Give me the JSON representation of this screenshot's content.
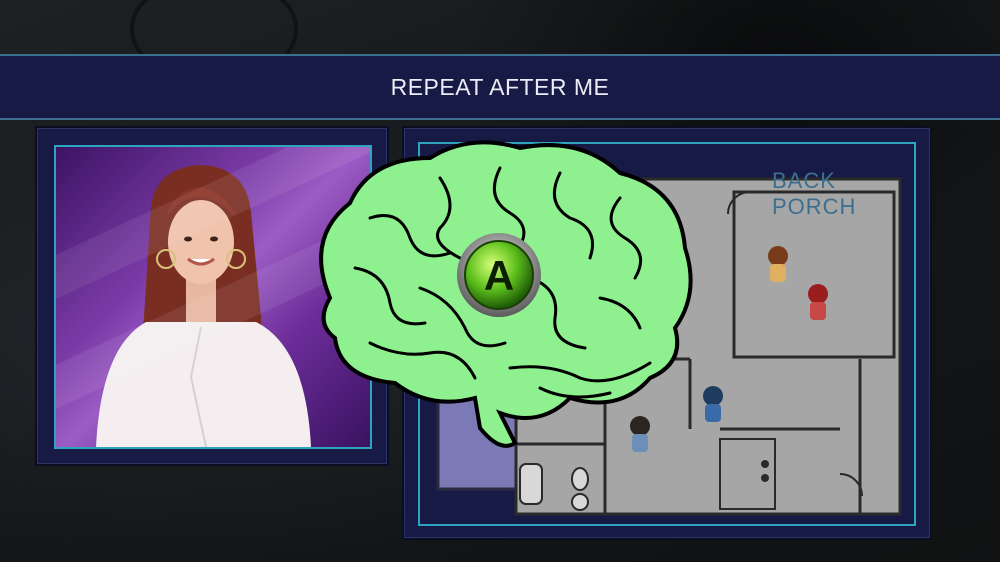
{
  "header": {
    "title": "REPEAT AFTER ME"
  },
  "map": {
    "location_label": "BACK PORCH"
  },
  "prompt_button": {
    "label": "A",
    "icon": "a-button-icon",
    "color": "#5ec01c"
  },
  "brain": {
    "icon": "brain-icon",
    "color": "#8ef08e"
  },
  "colors": {
    "panel": "#161a45",
    "accent": "#2fa4c0",
    "floor": "#a6a6a6"
  }
}
